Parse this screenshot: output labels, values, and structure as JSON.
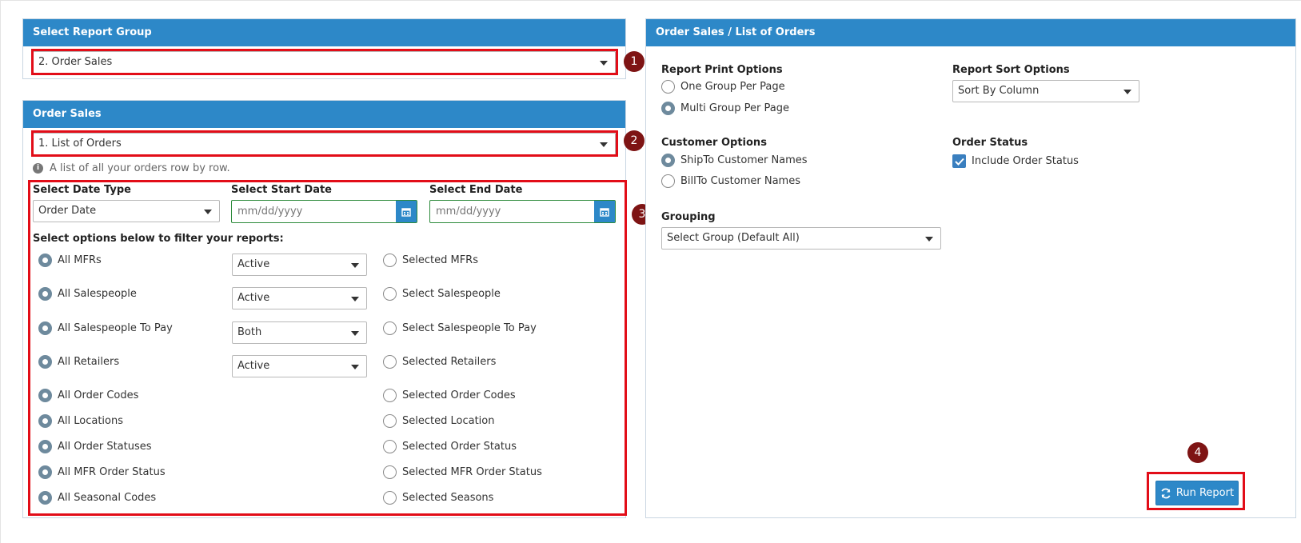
{
  "report_group_panel": {
    "title": "Select Report Group",
    "selected": "2. Order Sales"
  },
  "order_sales_panel": {
    "title": "Order Sales",
    "selected": "1. List of Orders",
    "info": "A list of all your orders row by row.",
    "date_type_label": "Select Date Type",
    "date_type_value": "Order Date",
    "start_date_label": "Select Start Date",
    "start_date_placeholder": "mm/dd/yyyy",
    "end_date_label": "Select End Date",
    "end_date_placeholder": "mm/dd/yyyy",
    "filter_heading": "Select options below to filter your reports:",
    "filters": [
      {
        "all_label": "All MFRs",
        "status": "Active",
        "selected_label": "Selected MFRs"
      },
      {
        "all_label": "All Salespeople",
        "status": "Active",
        "selected_label": "Select Salespeople"
      },
      {
        "all_label": "All Salespeople To Pay",
        "status": "Both",
        "selected_label": "Select Salespeople To Pay"
      },
      {
        "all_label": "All Retailers",
        "status": "Active",
        "selected_label": "Selected Retailers"
      },
      {
        "all_label": "All Order Codes",
        "selected_label": "Selected Order Codes"
      },
      {
        "all_label": "All Locations",
        "selected_label": "Selected Location"
      },
      {
        "all_label": "All Order Statuses",
        "selected_label": "Selected Order Status"
      },
      {
        "all_label": "All MFR Order Status",
        "selected_label": "Selected MFR Order Status"
      },
      {
        "all_label": "All Seasonal Codes",
        "selected_label": "Selected Seasons"
      }
    ]
  },
  "options_panel": {
    "title": "Order Sales / List of Orders",
    "print_options_label": "Report Print Options",
    "print_options": [
      "One Group Per Page",
      "Multi Group Per Page"
    ],
    "sort_options_label": "Report Sort Options",
    "sort_value": "Sort By Column",
    "customer_options_label": "Customer Options",
    "customer_options": [
      "ShipTo Customer Names",
      "BillTo Customer Names"
    ],
    "order_status_label": "Order Status",
    "include_order_status": "Include Order Status",
    "grouping_label": "Grouping",
    "grouping_value": "Select Group (Default All)",
    "run_button": "Run Report"
  },
  "badges": [
    "1",
    "2",
    "3",
    "4"
  ],
  "colors": {
    "header_blue": "#2d88c8",
    "highlight_red": "#e20d18",
    "badge_maroon": "#7e1414",
    "date_border_green": "#2e8b3c"
  },
  "icons": [
    "caret-down-icon",
    "calendar-icon",
    "info-icon",
    "refresh-icon",
    "checkmark-icon"
  ]
}
